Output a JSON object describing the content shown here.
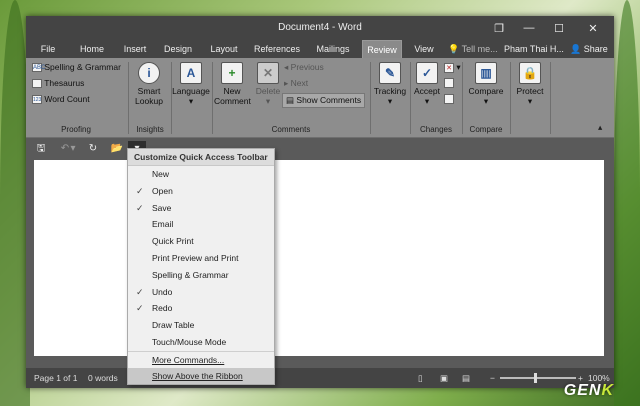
{
  "window": {
    "title": "Document4 - Word",
    "controls": {
      "restore": "❐",
      "minimize": "—",
      "maximize": "☐",
      "close": "✕"
    }
  },
  "tabs": [
    {
      "label": "File"
    },
    {
      "label": "Home"
    },
    {
      "label": "Insert"
    },
    {
      "label": "Design"
    },
    {
      "label": "Layout"
    },
    {
      "label": "References"
    },
    {
      "label": "Mailings"
    },
    {
      "label": "Review"
    },
    {
      "label": "View"
    }
  ],
  "tell_me": "Tell me...",
  "user_name": "Pham Thai H...",
  "share_label": "Share",
  "ribbon": {
    "proofing": {
      "spelling": "Spelling & Grammar",
      "thesaurus": "Thesaurus",
      "word_count": "Word Count",
      "label": "Proofing"
    },
    "insights": {
      "smart_lookup_1": "Smart",
      "smart_lookup_2": "Lookup",
      "label": "Insights"
    },
    "language": {
      "label": "Language"
    },
    "comments": {
      "new_comment_1": "New",
      "new_comment_2": "Comment",
      "delete": "Delete",
      "previous": "Previous",
      "next": "Next",
      "show_comments": "Show Comments",
      "label": "Comments"
    },
    "tracking": {
      "label": "Tracking"
    },
    "changes": {
      "accept": "Accept",
      "label": "Changes"
    },
    "compare": {
      "compare": "Compare",
      "label": "Compare"
    },
    "protect": {
      "label": "Protect"
    }
  },
  "qat": {
    "save_icon": "🖫",
    "undo_icon": "↶",
    "redo_icon": "↻",
    "open_icon": "📂",
    "customize_icon": "▾"
  },
  "menu": {
    "title": "Customize Quick Access Toolbar",
    "items": [
      {
        "label": "New",
        "checked": false
      },
      {
        "label": "Open",
        "checked": true
      },
      {
        "label": "Save",
        "checked": true
      },
      {
        "label": "Email",
        "checked": false
      },
      {
        "label": "Quick Print",
        "checked": false
      },
      {
        "label": "Print Preview and Print",
        "checked": false
      },
      {
        "label": "Spelling & Grammar",
        "checked": false
      },
      {
        "label": "Undo",
        "checked": true
      },
      {
        "label": "Redo",
        "checked": true
      },
      {
        "label": "Draw Table",
        "checked": false
      },
      {
        "label": "Touch/Mouse Mode",
        "checked": false
      },
      {
        "label": "More Commands...",
        "checked": false
      },
      {
        "label": "Show Above the Ribbon",
        "checked": false
      }
    ],
    "check_glyph": "✓"
  },
  "status": {
    "page": "Page 1 of 1",
    "words": "0 words",
    "zoom": "100%",
    "zoom_minus": "−",
    "zoom_plus": "+"
  },
  "watermark": {
    "a": "GEN",
    "b": "K"
  }
}
